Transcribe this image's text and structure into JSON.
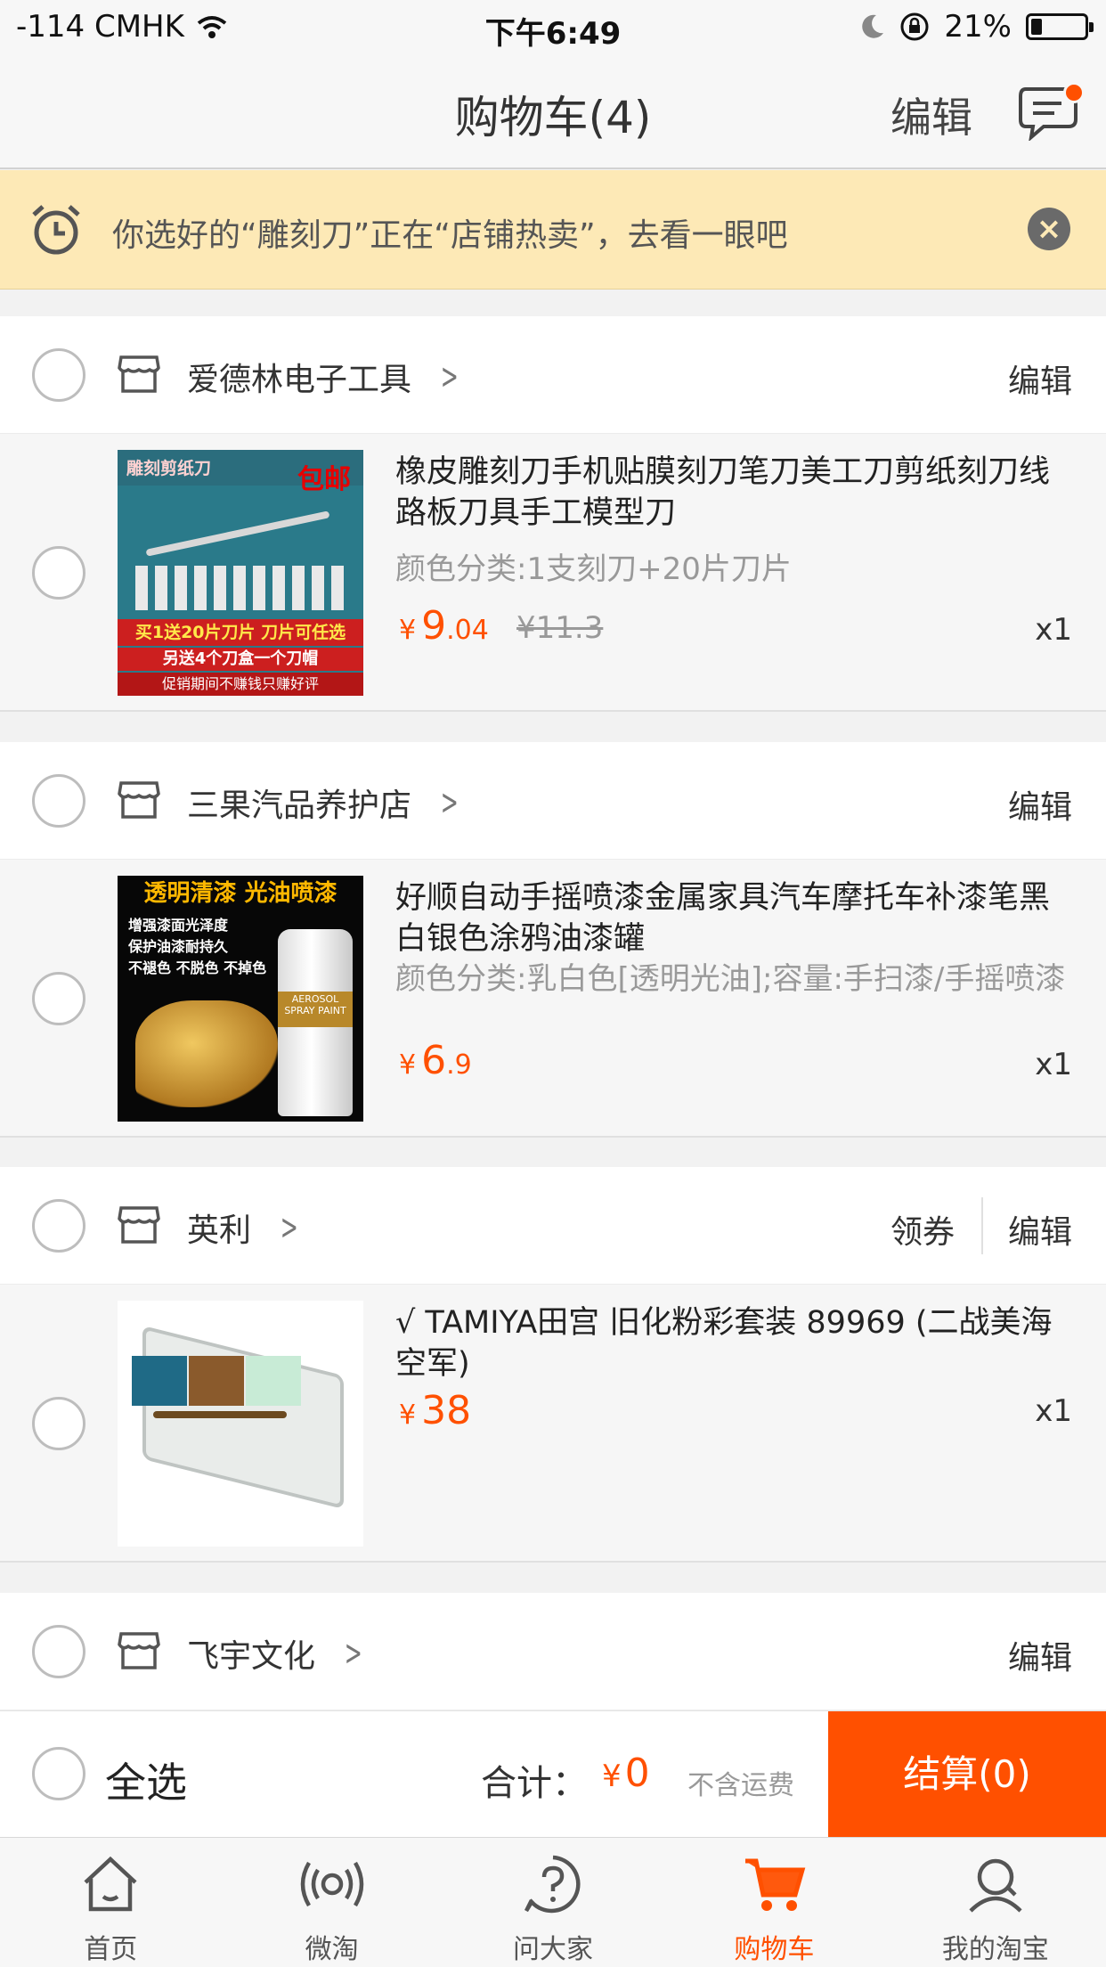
{
  "status_bar": {
    "carrier": "-114 CMHK",
    "time": "下午6:49",
    "battery": "21%",
    "battery_level": 0.21
  },
  "nav": {
    "title": "购物车(4)",
    "edit": "编辑"
  },
  "notice": {
    "text": "你选好的“雕刻刀”正在“店铺热卖”，去看一眼吧"
  },
  "stores": [
    {
      "name": "爱德林电子工具",
      "edit": "编辑",
      "item": {
        "title": "橡皮雕刻刀手机贴膜刻刀笔刀美工刀剪纸刻刀线路板刀具手工模型刀",
        "sku": "颜色分类:1支刻刀+20片刀片",
        "price_symbol": "¥",
        "price_int": "9",
        "price_dec": ".04",
        "old_price": "¥11.3",
        "qty": "x1",
        "thumb_texts": [
          "雕刻剪纸刀",
          "包邮",
          "买1送20片刀片 刀片可任选",
          "另送4个刀盒一个刀帽",
          "促销期间不赚钱只赚好评"
        ]
      }
    },
    {
      "name": "三果汽品养护店",
      "edit": "编辑",
      "item": {
        "title": "好顺自动手摇喷漆金属家具汽车摩托车补漆笔黑白银色涂鸦油漆罐",
        "sku": "颜色分类:乳白色[透明光油];容量:手扫漆/手摇喷漆",
        "price_symbol": "¥",
        "price_int": "6",
        "price_dec": ".9",
        "qty": "x1",
        "thumb_texts": [
          "透明清漆 光油喷漆",
          "增强漆面光泽度",
          "保护油漆耐持久",
          "不褪色 不脱色 不掉色",
          "AEROSOL SPRAY PAINT"
        ]
      }
    },
    {
      "name": "英利",
      "coupon": "领券",
      "edit": "编辑",
      "item": {
        "title": "√ TAMIYA田宫 旧化粉彩套装 89969 (二战美海空军)",
        "price_symbol": "¥",
        "price_int": "38",
        "qty": "x1"
      }
    },
    {
      "name": "飞宇文化",
      "edit": "编辑"
    }
  ],
  "checkout": {
    "select_all": "全选",
    "total_label": "合计：",
    "total_symbol": "¥",
    "total_value": "0",
    "shipping": "不含运费",
    "button": "结算(0)"
  },
  "tabs": [
    {
      "label": "首页",
      "icon": "home-icon"
    },
    {
      "label": "微淘",
      "icon": "broadcast-icon"
    },
    {
      "label": "问大家",
      "icon": "question-icon"
    },
    {
      "label": "购物车",
      "icon": "cart-icon",
      "active": true
    },
    {
      "label": "我的淘宝",
      "icon": "profile-icon"
    }
  ],
  "colors": {
    "accent": "#ff5000",
    "notice_bg": "#fde9b6"
  }
}
